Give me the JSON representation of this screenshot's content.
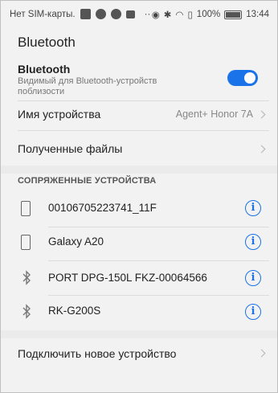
{
  "status_bar": {
    "carrier": "Нет SIM-карты.",
    "battery": "100%",
    "time": "13:44"
  },
  "header": {
    "title": "Bluetooth"
  },
  "bluetooth_toggle": {
    "label": "Bluetooth",
    "subtitle_line1": "Видимый для Bluetooth-устройств",
    "subtitle_line2": "поблизости",
    "enabled": true,
    "accent": "#1a73e8"
  },
  "device_name": {
    "label": "Имя устройства",
    "value": "Agent+ Honor 7A"
  },
  "received_files": {
    "label": "Полученные файлы"
  },
  "paired_section": {
    "title": "СОПРЯЖЕННЫЕ УСТРОЙСТВА"
  },
  "paired_devices": [
    {
      "name": "00106705223741_11F",
      "icon": "phone-icon"
    },
    {
      "name": "Galaxy A20",
      "icon": "phone-icon"
    },
    {
      "name": "PORT DPG-150L FKZ-00064566",
      "icon": "bluetooth-icon"
    },
    {
      "name": "RK-G200S",
      "icon": "bluetooth-icon"
    }
  ],
  "pair_new": {
    "label": "Подключить новое устройство"
  }
}
